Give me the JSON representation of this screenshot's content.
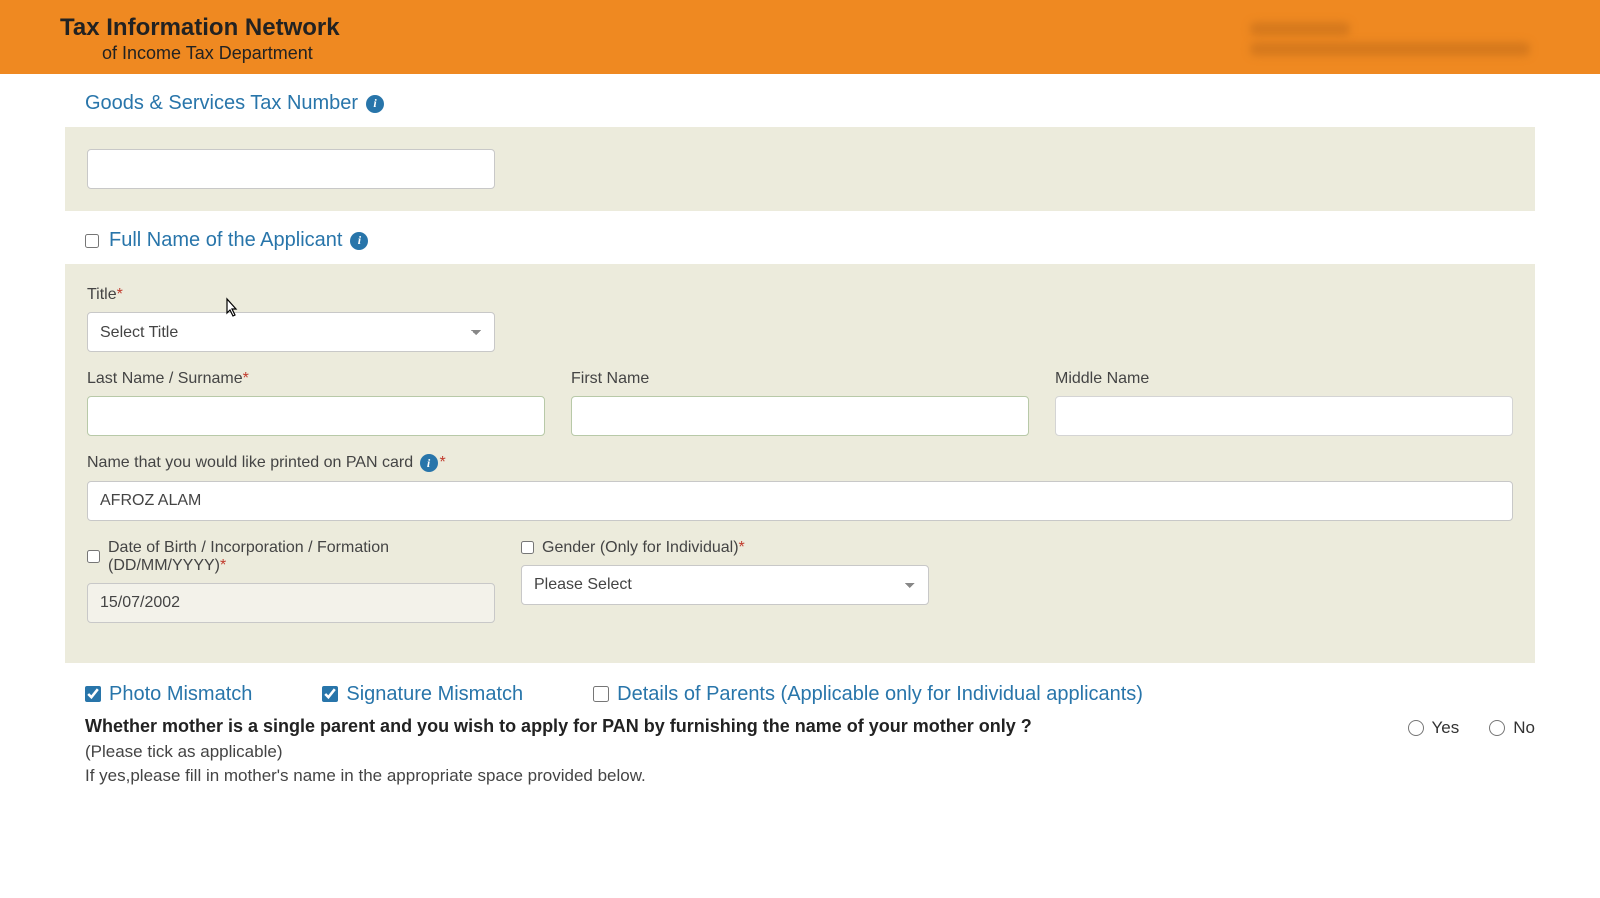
{
  "header": {
    "title": "Tax Information Network",
    "subtitle": "of Income Tax Department"
  },
  "sections": {
    "gst": {
      "title": "Goods & Services Tax Number",
      "value": ""
    },
    "name": {
      "title": "Full Name of the Applicant",
      "title_label": "Title",
      "title_placeholder": "Select Title",
      "last_label": "Last Name / Surname",
      "first_label": "First Name",
      "middle_label": "Middle Name",
      "last_value": "",
      "first_value": "",
      "middle_value": "",
      "print_label": "Name that you would like printed on PAN card",
      "print_value": "AFROZ ALAM",
      "dob_label": "Date of Birth / Incorporation / Formation (DD/MM/YYYY)",
      "dob_value": "15/07/2002",
      "gender_label": "Gender (Only for Individual)",
      "gender_placeholder": "Please Select"
    },
    "mismatch": {
      "photo": "Photo Mismatch",
      "signature": "Signature Mismatch",
      "parents": "Details of Parents (Applicable only for Individual applicants)"
    },
    "motherQ": {
      "question": "Whether mother is a single parent and you wish to apply for PAN by furnishing the name of your mother only ?",
      "yes": "Yes",
      "no": "No",
      "hint1": "(Please tick as applicable)",
      "hint2": "If yes,please fill in mother's name in the appropriate space provided below."
    }
  }
}
